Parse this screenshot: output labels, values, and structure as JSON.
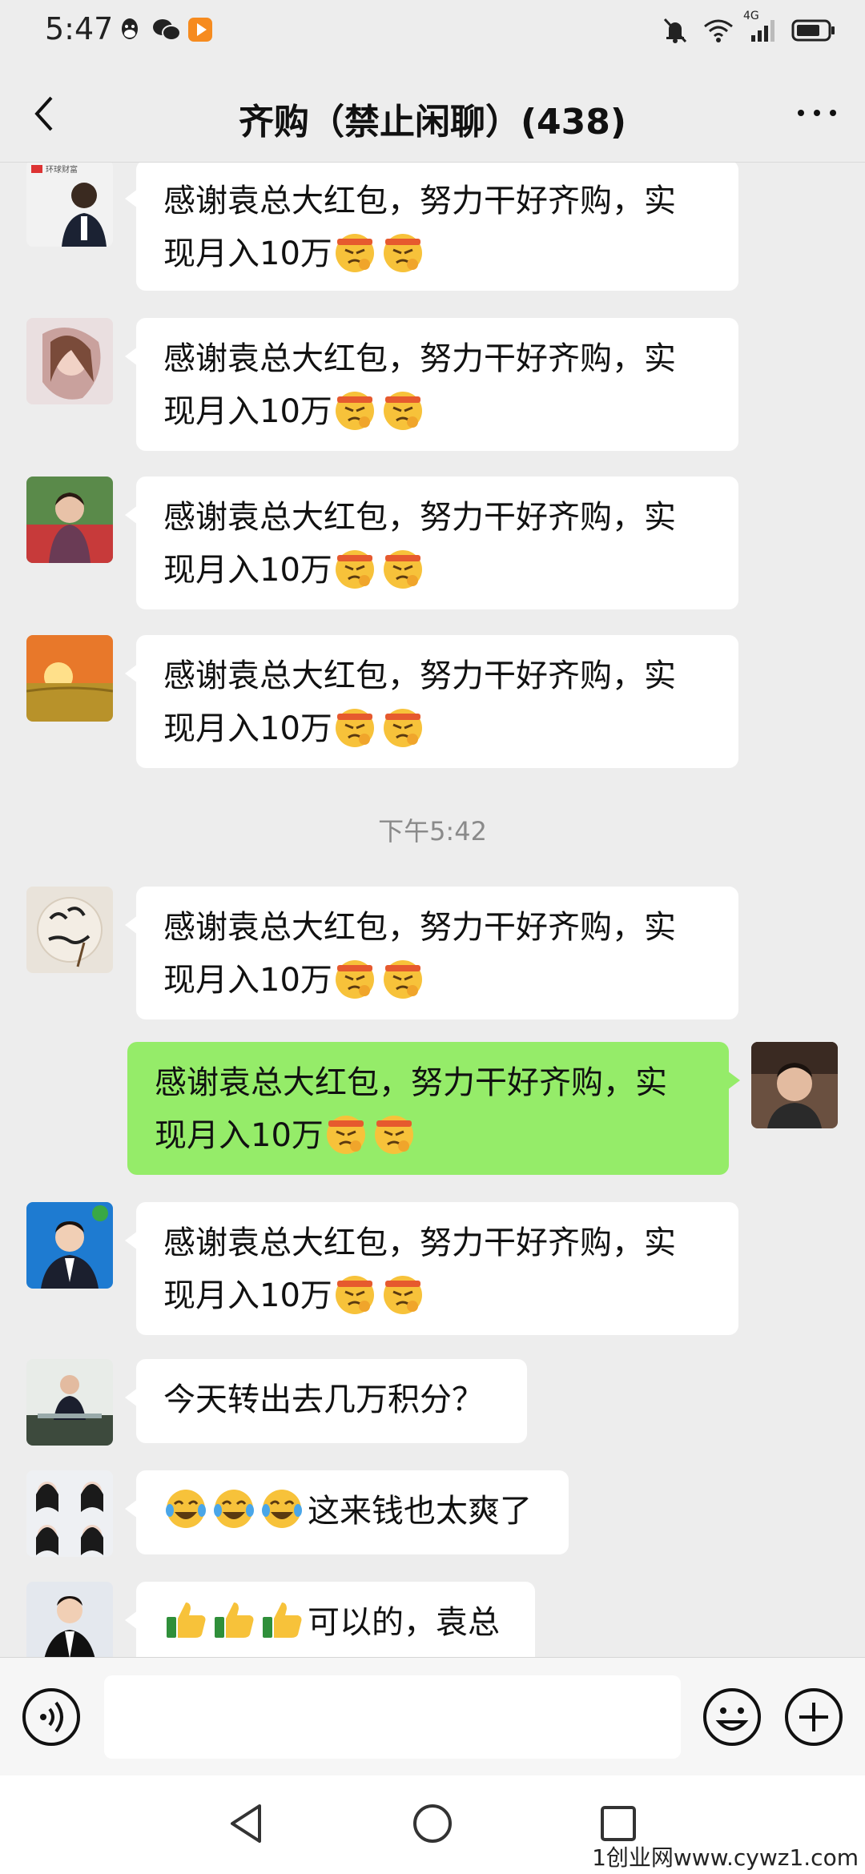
{
  "status": {
    "time": "5:47",
    "network": "4G"
  },
  "nav": {
    "title": "齐购（禁止闲聊）(438)"
  },
  "colors": {
    "background": "#ededed",
    "bubble_other": "#ffffff",
    "bubble_mine": "#95ec69"
  },
  "messages": [
    {
      "sender": "other",
      "line1": "感谢袁总大红包，努力干好齐购，实",
      "line2": "现月入10万",
      "emojis": [
        "headband-emoji",
        "headband-emoji"
      ],
      "avatar_text": "环球财富"
    },
    {
      "sender": "other",
      "line1": "感谢袁总大红包，努力干好齐购，实",
      "line2": "现月入10万",
      "emojis": [
        "headband-emoji",
        "headband-emoji"
      ]
    },
    {
      "sender": "other",
      "line1": "感谢袁总大红包，努力干好齐购，实",
      "line2": "现月入10万",
      "emojis": [
        "headband-emoji",
        "headband-emoji"
      ]
    },
    {
      "sender": "other",
      "line1": "感谢袁总大红包，努力干好齐购，实",
      "line2": "现月入10万",
      "emojis": [
        "headband-emoji",
        "headband-emoji"
      ]
    },
    {
      "sender": "other",
      "line1": "感谢袁总大红包，努力干好齐购，实",
      "line2": "现月入10万",
      "emojis": [
        "headband-emoji",
        "headband-emoji"
      ]
    },
    {
      "sender": "me",
      "line1": "感谢袁总大红包，努力干好齐购，实",
      "line2": "现月入10万",
      "emojis": [
        "headband-emoji",
        "headband-emoji"
      ]
    },
    {
      "sender": "other",
      "line1": "感谢袁总大红包，努力干好齐购，实",
      "line2": "现月入10万",
      "emojis": [
        "headband-emoji",
        "headband-emoji"
      ]
    },
    {
      "sender": "other",
      "line1": "今天转出去几万积分？"
    },
    {
      "sender": "other",
      "line1": "这来钱也太爽了",
      "lead_emojis": [
        "laughing-tears-emoji",
        "laughing-tears-emoji",
        "laughing-tears-emoji"
      ]
    },
    {
      "sender": "other",
      "line1": "可以的，袁总",
      "lead_emojis": [
        "thumbs-up-emoji",
        "thumbs-up-emoji",
        "thumbs-up-emoji"
      ]
    }
  ],
  "timestamp": "下午5:42",
  "input": {
    "placeholder": ""
  },
  "watermark": "1创业网www.cywz1.com"
}
